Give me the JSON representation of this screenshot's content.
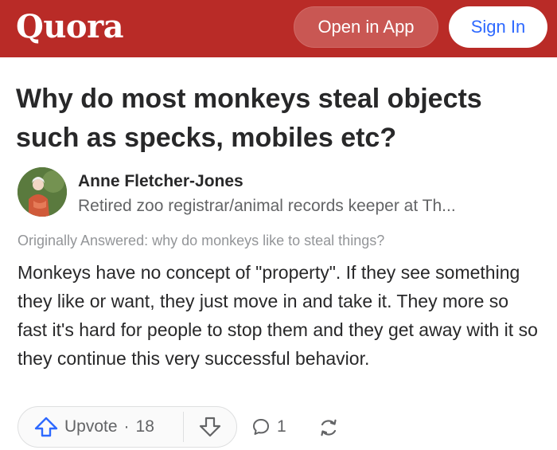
{
  "header": {
    "logo": "Quora",
    "open_in_app_label": "Open in App",
    "sign_in_label": "Sign In",
    "brand_color": "#b92b27",
    "link_color": "#2e69ff"
  },
  "question": {
    "title": "Why do most monkeys steal objects such as specks, mobiles etc?"
  },
  "answer": {
    "author_name": "Anne Fletcher-Jones",
    "author_credential": "Retired zoo registrar/animal records keeper at Th...",
    "originally_answered": "Originally Answered: why do monkeys like to steal things?",
    "body": "Monkeys have no concept of \"property\". If they see something they like or want, they just move in and take it. They more so fast it's hard for people to stop them and they get away with it so they continue this very successful behavior."
  },
  "actions": {
    "upvote_label": "Upvote",
    "separator": "·",
    "upvote_count": "18",
    "comment_count": "1",
    "icons": [
      "upvote-icon",
      "downvote-icon",
      "comment-icon",
      "share-icon"
    ]
  }
}
